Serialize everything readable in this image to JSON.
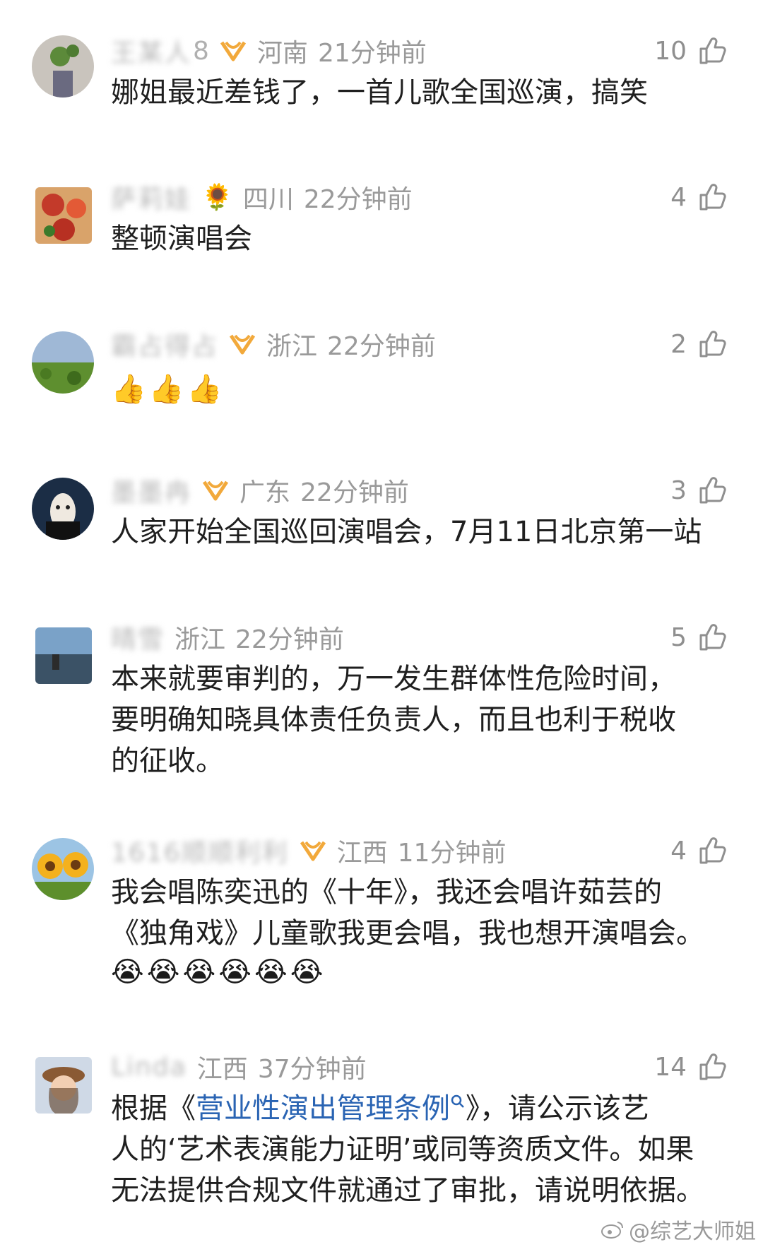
{
  "comments": [
    {
      "name": "王某人",
      "name_tail": "8",
      "region": "河南",
      "time": "21分钟前",
      "likes": "10",
      "text": "娜姐最近差钱了，一首儿歌全国巡演，搞笑"
    },
    {
      "name": "萨莉娃",
      "region": "四川",
      "time": "22分钟前",
      "likes": "4",
      "text": "整顿演唱会",
      "name_icon": "sunflower-icon"
    },
    {
      "name": "霸占得占",
      "region": "浙江",
      "time": "22分钟前",
      "likes": "2",
      "emojis": [
        "👍",
        "👍",
        "👍"
      ]
    },
    {
      "name": "墨墨冉",
      "region": "广东",
      "time": "22分钟前",
      "likes": "3",
      "text": "人家开始全国巡回演唱会，7月11日北京第一站"
    },
    {
      "name": "晴雪",
      "region": "浙江",
      "time": "22分钟前",
      "likes": "5",
      "text": "本来就要审判的，万一发生群体性危险时间，\n要明确知晓具体责任负责人，而且也利于税收\n的征收。"
    },
    {
      "name": "1616顺顺利利",
      "region": "江西",
      "time": "11分钟前",
      "likes": "4",
      "text": "我会唱陈奕迅的《十年》，我还会唱许茹芸的\n《独角戏》儿童歌我更会唱，我也想开演唱会。",
      "emojis": [
        "😭",
        "😭",
        "😭",
        "😭",
        "😭",
        "😭"
      ]
    },
    {
      "name": "Linda",
      "region": "江西",
      "time": "37分钟前",
      "likes": "14",
      "text_before": "根据《",
      "link": "营业性演出管理条例",
      "text_after": "》，请公示该艺\n人的‘艺术表演能力证明’或同等资质文件。如果\n无法提供合规文件就通过了审批，请说明依据。"
    }
  ],
  "watermark": "@综艺大师姐",
  "colors": {
    "badge": "#f2a93b",
    "link": "#2a64b3"
  }
}
